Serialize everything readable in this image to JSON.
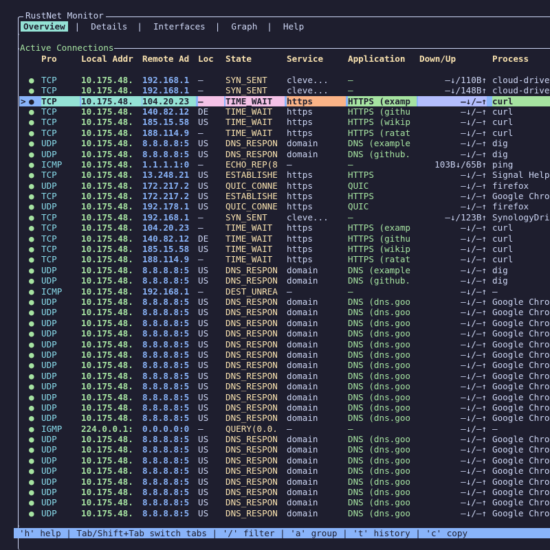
{
  "app": {
    "title": "RustNet Monitor"
  },
  "tabs": [
    {
      "label": "Overview",
      "active": true
    },
    {
      "label": "Details",
      "active": false
    },
    {
      "label": "Interfaces",
      "active": false
    },
    {
      "label": "Graph",
      "active": false
    },
    {
      "label": "Help",
      "active": false
    }
  ],
  "tab_separator": "|",
  "connections": {
    "title": "Active Connections",
    "columns": [
      "Pro",
      "Local Addr",
      "Remote Ad",
      "Loc",
      "State",
      "Service",
      "Application",
      "Down/Up",
      "Process"
    ],
    "selected_marker": ">",
    "status_dot": "●",
    "rows": [
      [
        "TCP",
        "10.175.48.",
        "192.168.1",
        "–",
        "SYN_SENT",
        "cleve...",
        "–",
        "–↓/110B↑",
        "cloud-drive"
      ],
      [
        "TCP",
        "10.175.48.",
        "192.168.1",
        "–",
        "SYN_SENT",
        "cleve...",
        "–",
        "–↓/148B↑",
        "cloud-drive"
      ],
      [
        "TCP",
        "10.175.48.",
        "104.20.23",
        "–",
        "TIME_WAIT",
        "https",
        "HTTPS (examp",
        "–↓/–↑",
        "curl"
      ],
      [
        "TCP",
        "10.175.48.",
        "140.82.12",
        "DE",
        "TIME_WAIT",
        "https",
        "HTTPS (githu",
        "–↓/–↑",
        "curl"
      ],
      [
        "TCP",
        "10.175.48.",
        "185.15.58",
        "US",
        "TIME_WAIT",
        "https",
        "HTTPS (wikip",
        "–↓/–↑",
        "curl"
      ],
      [
        "TCP",
        "10.175.48.",
        "188.114.9",
        "–",
        "TIME_WAIT",
        "https",
        "HTTPS (ratat",
        "–↓/–↑",
        "curl"
      ],
      [
        "UDP",
        "10.175.48.",
        "8.8.8.8:5",
        "US",
        "DNS_RESPON",
        "domain",
        "DNS (example",
        "–↓/–↑",
        "dig"
      ],
      [
        "UDP",
        "10.175.48.",
        "8.8.8.8:5",
        "US",
        "DNS_RESPON",
        "domain",
        "DNS (github.",
        "–↓/–↑",
        "dig"
      ],
      [
        "ICMP",
        "10.175.48.",
        "1.1.1.1:0",
        "–",
        "ECHO_REP(8",
        "–",
        "–",
        "103B↓/65B↑",
        "ping"
      ],
      [
        "TCP",
        "10.175.48.",
        "13.248.21",
        "US",
        "ESTABLISHE",
        "https",
        "HTTPS",
        "–↓/–↑",
        "Signal Help"
      ],
      [
        "UDP",
        "10.175.48.",
        "172.217.2",
        "US",
        "QUIC_CONNE",
        "https",
        "QUIC",
        "–↓/–↑",
        "firefox"
      ],
      [
        "TCP",
        "10.175.48.",
        "172.217.2",
        "US",
        "ESTABLISHE",
        "https",
        "HTTPS",
        "–↓/–↑",
        "Google Chro"
      ],
      [
        "UDP",
        "10.175.48.",
        "192.178.1",
        "US",
        "QUIC_CONNE",
        "https",
        "QUIC",
        "–↓/–↑",
        "firefox"
      ],
      [
        "TCP",
        "10.175.48.",
        "192.168.1",
        "–",
        "SYN_SENT",
        "cleve...",
        "–",
        "–↓/123B↑",
        "SynologyDri"
      ],
      [
        "TCP",
        "10.175.48.",
        "104.20.23",
        "–",
        "TIME_WAIT",
        "https",
        "HTTPS (examp",
        "–↓/–↑",
        "curl"
      ],
      [
        "TCP",
        "10.175.48.",
        "140.82.12",
        "DE",
        "TIME_WAIT",
        "https",
        "HTTPS (githu",
        "–↓/–↑",
        "curl"
      ],
      [
        "TCP",
        "10.175.48.",
        "185.15.58",
        "US",
        "TIME_WAIT",
        "https",
        "HTTPS (wikip",
        "–↓/–↑",
        "curl"
      ],
      [
        "TCP",
        "10.175.48.",
        "188.114.9",
        "–",
        "TIME_WAIT",
        "https",
        "HTTPS (ratat",
        "–↓/–↑",
        "curl"
      ],
      [
        "UDP",
        "10.175.48.",
        "8.8.8.8:5",
        "US",
        "DNS_RESPON",
        "domain",
        "DNS (example",
        "–↓/–↑",
        "dig"
      ],
      [
        "UDP",
        "10.175.48.",
        "8.8.8.8:5",
        "US",
        "DNS_RESPON",
        "domain",
        "DNS (github.",
        "–↓/–↑",
        "dig"
      ],
      [
        "ICMP",
        "10.175.48.",
        "192.168.1",
        "–",
        "DEST_UNREA",
        "–",
        "–",
        "–↓/–↑",
        "–"
      ],
      [
        "UDP",
        "10.175.48.",
        "8.8.8.8:5",
        "US",
        "DNS_RESPON",
        "domain",
        "DNS (dns.goo",
        "–↓/–↑",
        "Google Chro"
      ],
      [
        "UDP",
        "10.175.48.",
        "8.8.8.8:5",
        "US",
        "DNS_RESPON",
        "domain",
        "DNS (dns.goo",
        "–↓/–↑",
        "Google Chro"
      ],
      [
        "UDP",
        "10.175.48.",
        "8.8.8.8:5",
        "US",
        "DNS_RESPON",
        "domain",
        "DNS (dns.goo",
        "–↓/–↑",
        "Google Chro"
      ],
      [
        "UDP",
        "10.175.48.",
        "8.8.8.8:5",
        "US",
        "DNS_RESPON",
        "domain",
        "DNS (dns.goo",
        "–↓/–↑",
        "Google Chro"
      ],
      [
        "UDP",
        "10.175.48.",
        "8.8.8.8:5",
        "US",
        "DNS_RESPON",
        "domain",
        "DNS (dns.goo",
        "–↓/–↑",
        "Google Chro"
      ],
      [
        "UDP",
        "10.175.48.",
        "8.8.8.8:5",
        "US",
        "DNS_RESPON",
        "domain",
        "DNS (dns.goo",
        "–↓/–↑",
        "Google Chro"
      ],
      [
        "UDP",
        "10.175.48.",
        "8.8.8.8:5",
        "US",
        "DNS_RESPON",
        "domain",
        "DNS (dns.goo",
        "–↓/–↑",
        "Google Chro"
      ],
      [
        "UDP",
        "10.175.48.",
        "8.8.8.8:5",
        "US",
        "DNS_RESPON",
        "domain",
        "DNS (dns.goo",
        "–↓/–↑",
        "Google Chro"
      ],
      [
        "UDP",
        "10.175.48.",
        "8.8.8.8:5",
        "US",
        "DNS_RESPON",
        "domain",
        "DNS (dns.goo",
        "–↓/–↑",
        "Google Chro"
      ],
      [
        "UDP",
        "10.175.48.",
        "8.8.8.8:5",
        "US",
        "DNS_RESPON",
        "domain",
        "DNS (dns.goo",
        "–↓/–↑",
        "Google Chro"
      ],
      [
        "UDP",
        "10.175.48.",
        "8.8.8.8:5",
        "US",
        "DNS_RESPON",
        "domain",
        "DNS (dns.goo",
        "–↓/–↑",
        "Google Chro"
      ],
      [
        "UDP",
        "10.175.48.",
        "8.8.8.8:5",
        "US",
        "DNS_RESPON",
        "domain",
        "DNS (dns.goo",
        "–↓/–↑",
        "Google Chro"
      ],
      [
        "IGMP",
        "224.0.0.1:",
        "0.0.0.0:0",
        "–",
        "QUERY(0.0.",
        "–",
        "–",
        "–↓/–↑",
        "–"
      ],
      [
        "UDP",
        "10.175.48.",
        "8.8.8.8:5",
        "US",
        "DNS_RESPON",
        "domain",
        "DNS (dns.goo",
        "–↓/–↑",
        "Google Chro"
      ],
      [
        "UDP",
        "10.175.48.",
        "8.8.8.8:5",
        "US",
        "DNS_RESPON",
        "domain",
        "DNS (dns.goo",
        "–↓/–↑",
        "Google Chro"
      ],
      [
        "UDP",
        "10.175.48.",
        "8.8.8.8:5",
        "US",
        "DNS_RESPON",
        "domain",
        "DNS (dns.goo",
        "–↓/–↑",
        "Google Chro"
      ],
      [
        "UDP",
        "10.175.48.",
        "8.8.8.8:5",
        "US",
        "DNS_RESPON",
        "domain",
        "DNS (dns.goo",
        "–↓/–↑",
        "Google Chro"
      ],
      [
        "UDP",
        "10.175.48.",
        "8.8.8.8:5",
        "US",
        "DNS_RESPON",
        "domain",
        "DNS (dns.goo",
        "–↓/–↑",
        "Google Chro"
      ],
      [
        "UDP",
        "10.175.48.",
        "8.8.8.8:5",
        "US",
        "DNS_RESPON",
        "domain",
        "DNS (dns.goo",
        "–↓/–↑",
        "Google Chro"
      ],
      [
        "UDP",
        "10.175.48.",
        "8.8.8.8:5",
        "US",
        "DNS_RESPON",
        "domain",
        "DNS (dns.goo",
        "–↓/–↑",
        "Google Chro"
      ],
      [
        "UDP",
        "10.175.48.",
        "8.8.8.8:5",
        "US",
        "DNS_RESPON",
        "domain",
        "DNS (dns.goo",
        "–↓/–↑",
        "Google Chro"
      ]
    ],
    "selected_index": 2
  },
  "statusbar": {
    "text": "'h' help | Tab/Shift+Tab switch tabs | '/' filter | 'a' group | 't' history | 'c' copy"
  },
  "colors": {
    "background": "#1e1e2e",
    "header": "#f9e2af",
    "active_tab": "#94e2d5",
    "selection": "#89b4fa",
    "status_dot": "#a6e3a1"
  }
}
